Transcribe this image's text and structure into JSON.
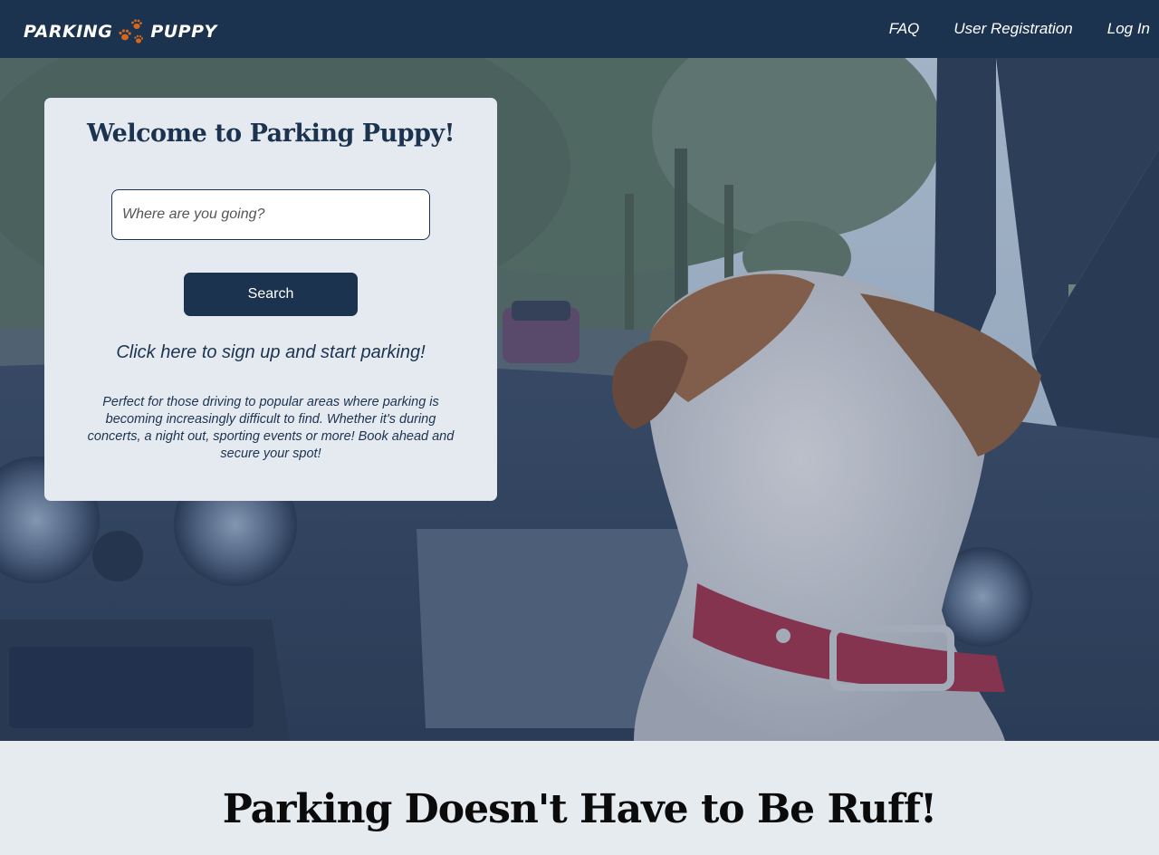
{
  "navbar": {
    "logo_left": "PARKING",
    "logo_right": "PUPPY",
    "logo_icon": "paw-prints-icon",
    "links": [
      "FAQ",
      "User Registration",
      "Log In"
    ]
  },
  "hero": {
    "card": {
      "title": "Welcome to Parking Puppy!",
      "search_placeholder": "Where are you going?",
      "search_value": "",
      "search_button": "Search",
      "signup_link": "Click here to sign up and start parking!",
      "description": "Perfect for those driving to popular areas where parking is becoming increasingly difficult to find. Whether it's during concerts, a night out, sporting events or more! Book ahead and secure your spot!"
    }
  },
  "bottom": {
    "heading": "Parking Doesn't Have to Be Ruff!"
  },
  "colors": {
    "navy": "#1c3350",
    "card_bg": "#e5eaf0",
    "paw_orange": "#d2691e"
  }
}
